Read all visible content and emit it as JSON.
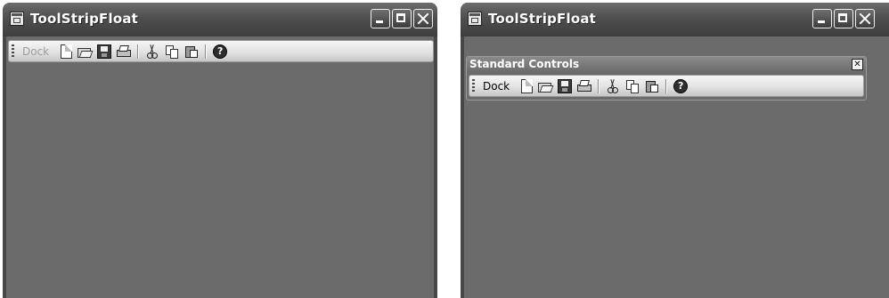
{
  "windows": {
    "left": {
      "title": "ToolStripFloat",
      "toolstrip": {
        "dock_label": "Dock",
        "dock_enabled": false
      }
    },
    "right": {
      "title": "ToolStripFloat",
      "floating_panel": {
        "title": "Standard Controls",
        "close_glyph": "✕"
      },
      "toolstrip": {
        "dock_label": "Dock",
        "dock_enabled": true
      }
    }
  },
  "toolbar_icons": [
    "new-icon",
    "open-icon",
    "save-icon",
    "print-icon",
    "cut-icon",
    "copy-icon",
    "paste-icon",
    "help-icon"
  ],
  "help_glyph": "?",
  "colors": {
    "client_background": "#6b6b6b",
    "titlebar": "#4f4f4f",
    "toolstrip_light": "#f6f6f6",
    "toolstrip_dark": "#c6c6c6",
    "disabled_text": "#9c9c9c"
  }
}
